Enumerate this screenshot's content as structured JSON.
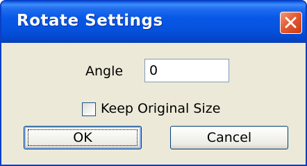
{
  "window": {
    "title": "Rotate Settings",
    "close_icon": "close-x-icon",
    "colors": {
      "title_bar": "#0858e6",
      "close_button": "#e35a32",
      "dialog_background": "#ece9d8"
    }
  },
  "form": {
    "angle_label": "Angle",
    "angle_value": "0",
    "keep_size_label": "Keep Original Size",
    "keep_size_checked": false
  },
  "buttons": {
    "ok_label": "OK",
    "cancel_label": "Cancel"
  }
}
